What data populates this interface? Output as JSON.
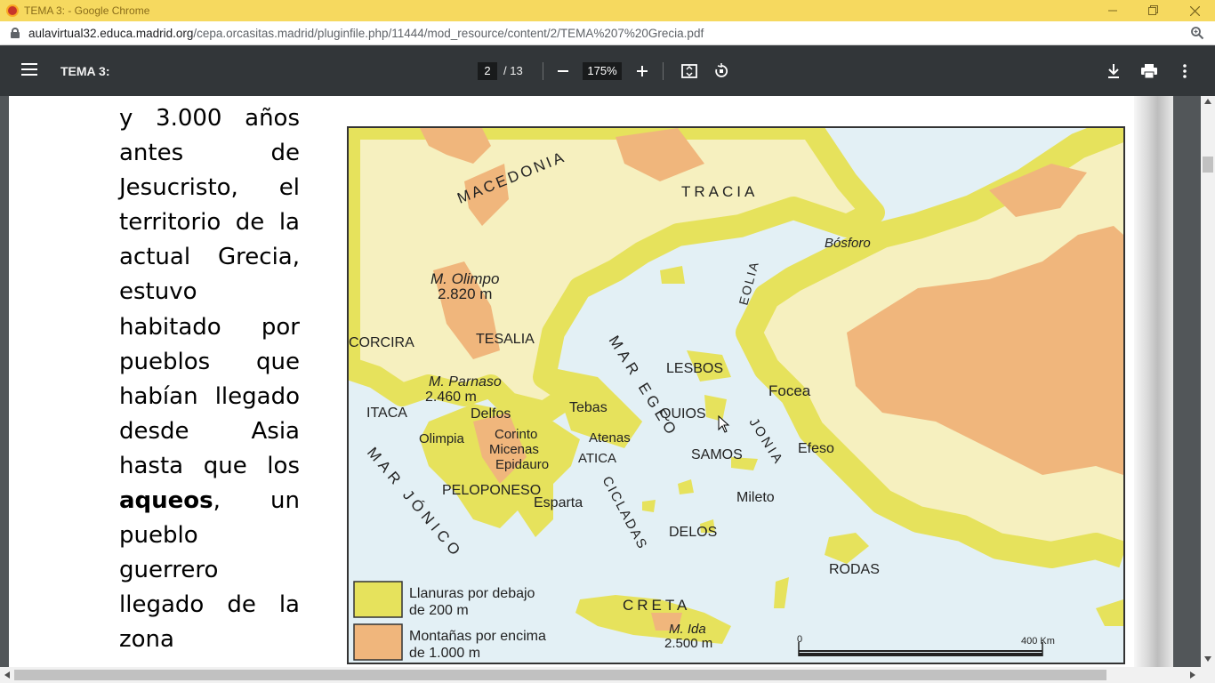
{
  "window": {
    "title": "TEMA 3: - Google Chrome",
    "controls": [
      "minimize",
      "restore",
      "close"
    ]
  },
  "address_bar": {
    "host": "aulavirtual32.educa.madrid.org",
    "path": "/cepa.orcasitas.madrid/pluginfile.php/11444/mod_resource/content/2/TEMA%207%20Grecia.pdf"
  },
  "pdf_toolbar": {
    "doc_title": "TEMA 3:",
    "current_page": "2",
    "total_pages": "/ 13",
    "zoom": "175%",
    "icons": [
      "menu-icon",
      "zoom-out-icon",
      "zoom-in-icon",
      "fit-page-icon",
      "rotate-icon",
      "download-icon",
      "print-icon",
      "more-icon"
    ]
  },
  "text_lines": [
    "y 3.000 años",
    "antes de",
    "Jesucristo, el",
    "territorio de la",
    "actual Grecia,",
    "estuvo",
    "habitado por",
    "pueblos que",
    "habían llegado",
    "desde Asia",
    "hasta que los",
    "un",
    "pueblo",
    "guerrero",
    "llegado de la",
    "zona"
  ],
  "text_bold_word": "aqueos",
  "text_bold_trailing": ",",
  "map": {
    "colors": {
      "sea": "#e3f0f5",
      "plain": "#e6e25c",
      "mid": "#f6f0bf",
      "mountain": "#f0b67c"
    },
    "labels": {
      "macedonia": "MACEDONIA",
      "tracia": "TRACIA",
      "bosforo": "Bósforo",
      "olimpo": "M. Olimpo",
      "olimpo_h": "2.820 m",
      "corcira": "CORCIRA",
      "tesalia": "TESALIA",
      "mar_egeo": "MAR EGEO",
      "eolia": "EOLIA",
      "lesbos": "LESBOS",
      "focea": "Focea",
      "parnaso": "M. Parnaso",
      "parnaso_h": "2.460 m",
      "itaca": "ITACA",
      "delfos1": "Delfos",
      "tebas": "Tebas",
      "quios": "QUIOS",
      "olimpia": "Olimpia",
      "corinto": "Corinto",
      "micenas": "Micenas",
      "atenas": "Atenas",
      "epidauro": "Epidauro",
      "atica": "ATICA",
      "samos": "SAMOS",
      "jonia": "JONIA",
      "efeso": "Efeso",
      "mar_jonico": "MAR JÓNICO",
      "peloponeso": "PELOPONESO",
      "esparta": "Esparta",
      "ciclades": "CICLADAS",
      "delos": "DELOS",
      "mileto": "Mileto",
      "rodas": "RODAS",
      "creta": "CRETA",
      "ida": "M. Ida",
      "ida_h": "2.500 m",
      "scale_0": "0",
      "scale_400": "400 Km"
    },
    "legend": [
      {
        "line1": "Llanuras por debajo",
        "line2": "de 200 m",
        "color": "#e6e25c"
      },
      {
        "line1": "Montañas por encima",
        "line2": "de 1.000 m",
        "color": "#f0b67c"
      }
    ]
  }
}
